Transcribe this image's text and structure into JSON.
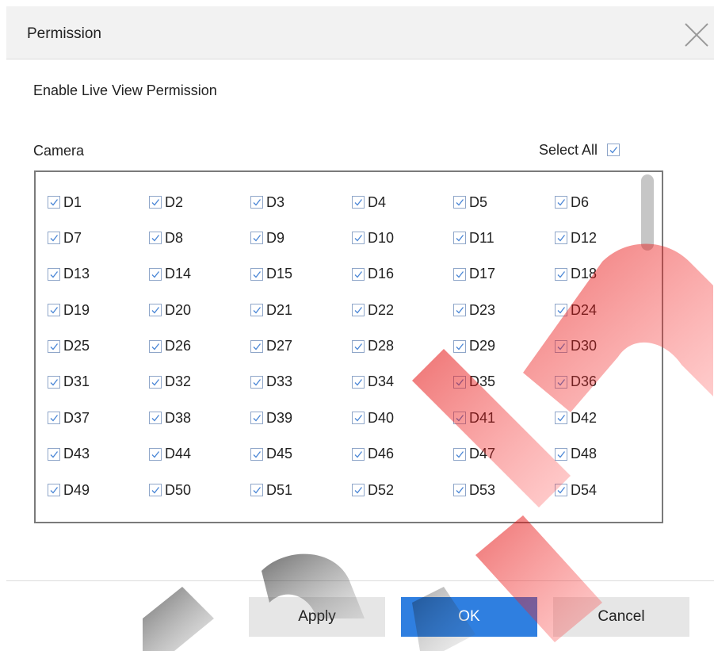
{
  "dialog": {
    "title": "Permission",
    "close_icon": "close-icon"
  },
  "section": {
    "label": "Enable Live View Permission"
  },
  "camera": {
    "label": "Camera",
    "select_all_label": "Select All",
    "select_all_checked": true,
    "items": [
      "D1",
      "D2",
      "D3",
      "D4",
      "D5",
      "D6",
      "D7",
      "D8",
      "D9",
      "D10",
      "D11",
      "D12",
      "D13",
      "D14",
      "D15",
      "D16",
      "D17",
      "D18",
      "D19",
      "D20",
      "D21",
      "D22",
      "D23",
      "D24",
      "D25",
      "D26",
      "D27",
      "D28",
      "D29",
      "D30",
      "D31",
      "D32",
      "D33",
      "D34",
      "D35",
      "D36",
      "D37",
      "D38",
      "D39",
      "D40",
      "D41",
      "D42",
      "D43",
      "D44",
      "D45",
      "D46",
      "D47",
      "D48",
      "D49",
      "D50",
      "D51",
      "D52",
      "D53",
      "D54"
    ],
    "all_checked": true
  },
  "footer": {
    "apply_label": "Apply",
    "ok_label": "OK",
    "cancel_label": "Cancel"
  },
  "colors": {
    "accent": "#2f7fe0",
    "checkbox_border": "#8fa6c9",
    "checkmark": "#4a86d6"
  }
}
